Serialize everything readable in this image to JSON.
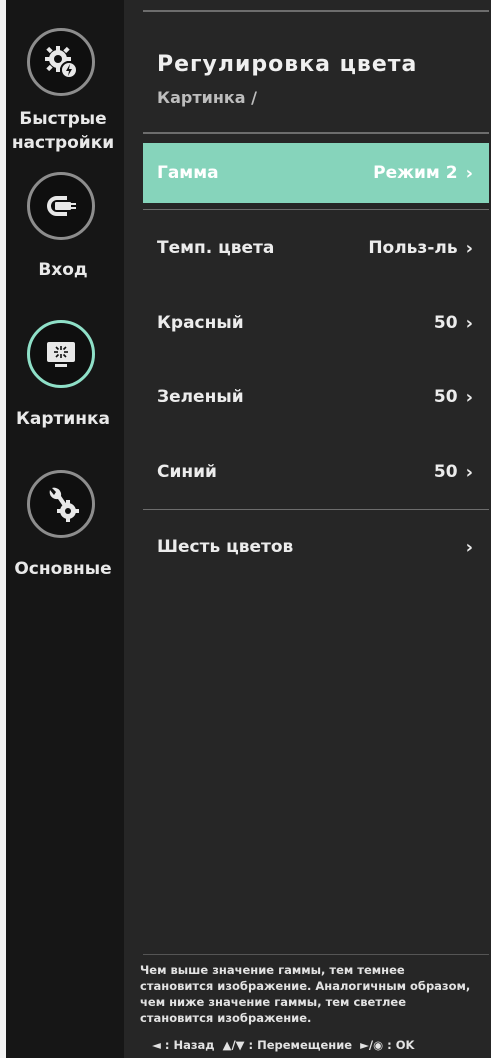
{
  "sidebar": {
    "items": [
      {
        "label": "Быстрые настройки",
        "icon": "gear-bolt-icon",
        "active": false
      },
      {
        "label": "Вход",
        "icon": "input-plug-icon",
        "active": false
      },
      {
        "label": "Картинка",
        "icon": "monitor-icon",
        "active": true
      },
      {
        "label": "Основные",
        "icon": "wrench-gear-icon",
        "active": false
      }
    ]
  },
  "header": {
    "title": "Регулировка цвета",
    "breadcrumb": "Картинка /"
  },
  "menu": {
    "items": [
      {
        "label": "Гамма",
        "value": "Режим 2",
        "chevron": "›",
        "selected": true
      },
      {
        "label": "Темп. цвета",
        "value": "Польз-ль",
        "chevron": "›"
      },
      {
        "label": "Красный",
        "value": "50",
        "chevron": "›"
      },
      {
        "label": "Зеленый",
        "value": "50",
        "chevron": "›"
      },
      {
        "label": "Синий",
        "value": "50",
        "chevron": "›"
      },
      {
        "label": "Шесть цветов",
        "value": "",
        "chevron": "›"
      }
    ]
  },
  "help": {
    "text": "Чем выше значение гаммы, тем темнее становится изображение. Аналогичным образом, чем ниже значение гаммы, тем светлее становится изображение."
  },
  "keys": {
    "back": "◄ : Назад",
    "move": "▲/▼ : Перемещение",
    "ok": "►/◉ : OK"
  },
  "colors": {
    "accent": "#86d4bb",
    "active_ring": "#8fe0c8",
    "panel": "#262626",
    "sidebar": "#161616"
  }
}
